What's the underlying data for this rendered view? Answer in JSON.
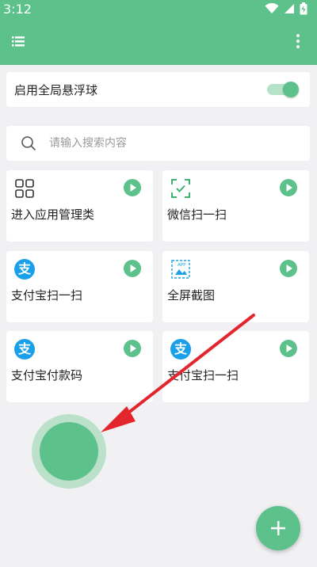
{
  "status_bar": {
    "time": "3:12"
  },
  "toggle": {
    "label": "启用全局悬浮球",
    "enabled": true
  },
  "search": {
    "placeholder": "请输入搜索内容"
  },
  "shortcuts": [
    {
      "label": "进入应用管理类",
      "icon": "grid-icon"
    },
    {
      "label": "微信扫一扫",
      "icon": "scan-icon"
    },
    {
      "label": "支付宝扫一扫",
      "icon": "alipay-icon",
      "icon_text": "支"
    },
    {
      "label": "全屏截图",
      "icon": "screenshot-icon",
      "icon_text": "APP"
    },
    {
      "label": "支付宝付款码",
      "icon": "alipay-icon",
      "icon_text": "支"
    },
    {
      "label": "支付宝扫一扫",
      "icon": "alipay-icon",
      "icon_text": "支"
    }
  ],
  "colors": {
    "primary": "#5cc18a",
    "accent_light": "#b6dfc6",
    "alipay": "#1aa0e8",
    "annotation_arrow": "#e3262d",
    "background": "#f1f1f3"
  }
}
